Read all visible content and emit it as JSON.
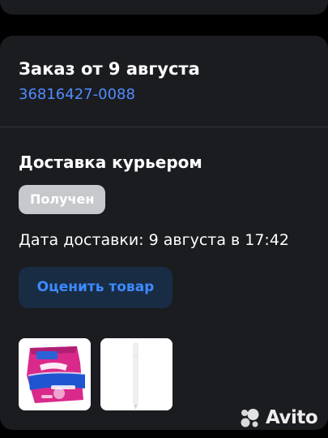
{
  "order": {
    "title": "Заказ от 9 августа",
    "number": "36816427-0088"
  },
  "delivery": {
    "type": "Доставка курьером",
    "status": "Получен",
    "date_text": "Дата доставки: 9 августа в 17:42"
  },
  "actions": {
    "rate_label": "Оценить товар"
  },
  "products": [
    {
      "icon": "ozon-package-image"
    },
    {
      "icon": "stylus-pen-image"
    }
  ],
  "watermark": {
    "brand": "Avito"
  },
  "colors": {
    "background": "#000000",
    "card": "#1b1c20",
    "link": "#4f8cff",
    "badge": "#c7c8cc",
    "button_bg": "#182c44",
    "button_text": "#3d8bff"
  }
}
